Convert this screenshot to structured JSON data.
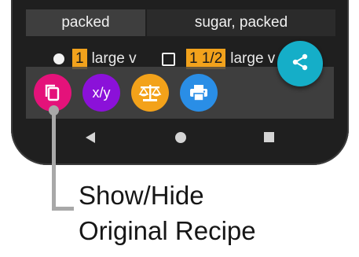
{
  "table": {
    "headers": [
      "packed",
      "sugar, packed"
    ],
    "row": {
      "left_qty": "1",
      "left_text": "large v",
      "right_qty": "1 1/2",
      "right_text": "large v"
    }
  },
  "toolbar": {
    "buttons": [
      {
        "name": "copy",
        "icon": "copy-icon",
        "color": "#e4127a"
      },
      {
        "name": "xy",
        "label": "x/y",
        "color": "#8b11d9"
      },
      {
        "name": "scale",
        "icon": "scale-icon",
        "color": "#f3a21a"
      },
      {
        "name": "print",
        "icon": "print-icon",
        "color": "#2a8ee6"
      }
    ],
    "share": {
      "icon": "share-icon",
      "color": "#15aec8"
    }
  },
  "nav": {
    "back": "back-icon",
    "home": "home-icon",
    "recents": "recents-icon"
  },
  "callout": {
    "line1": "Show/Hide",
    "line2": "Original Recipe"
  }
}
